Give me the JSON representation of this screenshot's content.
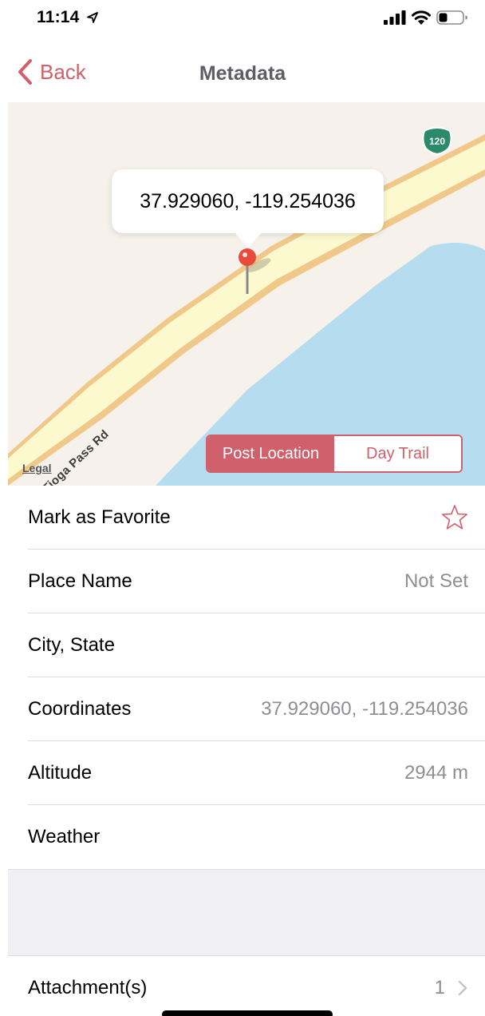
{
  "status_bar": {
    "time": "11:14",
    "icons": [
      "location-arrow-icon",
      "signal-icon",
      "wifi-icon",
      "battery-icon"
    ]
  },
  "nav": {
    "back_label": "Back",
    "title": "Metadata"
  },
  "map": {
    "callout_text": "37.929060, -119.254036",
    "road_label": "Tioga Pass Rd",
    "highway_number": "120",
    "legal_label": "Legal",
    "segments": [
      {
        "label": "Post Location",
        "selected": true
      },
      {
        "label": "Day Trail",
        "selected": false
      }
    ]
  },
  "rows": [
    {
      "label": "Mark as Favorite",
      "value": "",
      "icon": "star-icon"
    },
    {
      "label": "Place Name",
      "value": "Not Set"
    },
    {
      "label": "City, State",
      "value": ""
    },
    {
      "label": "Coordinates",
      "value": "37.929060, -119.254036"
    },
    {
      "label": "Altitude",
      "value": "2944 m"
    },
    {
      "label": "Weather",
      "value": ""
    }
  ],
  "attachments": {
    "label": "Attachment(s)",
    "count": "1"
  },
  "colors": {
    "accent": "#d0606b",
    "secondary_text": "#8e8e93",
    "water": "#b5ddef",
    "road": "#fdf9cf",
    "road_edge": "#f0c98a",
    "land": "#f6f2eb",
    "section_gap": "#efeff4"
  }
}
